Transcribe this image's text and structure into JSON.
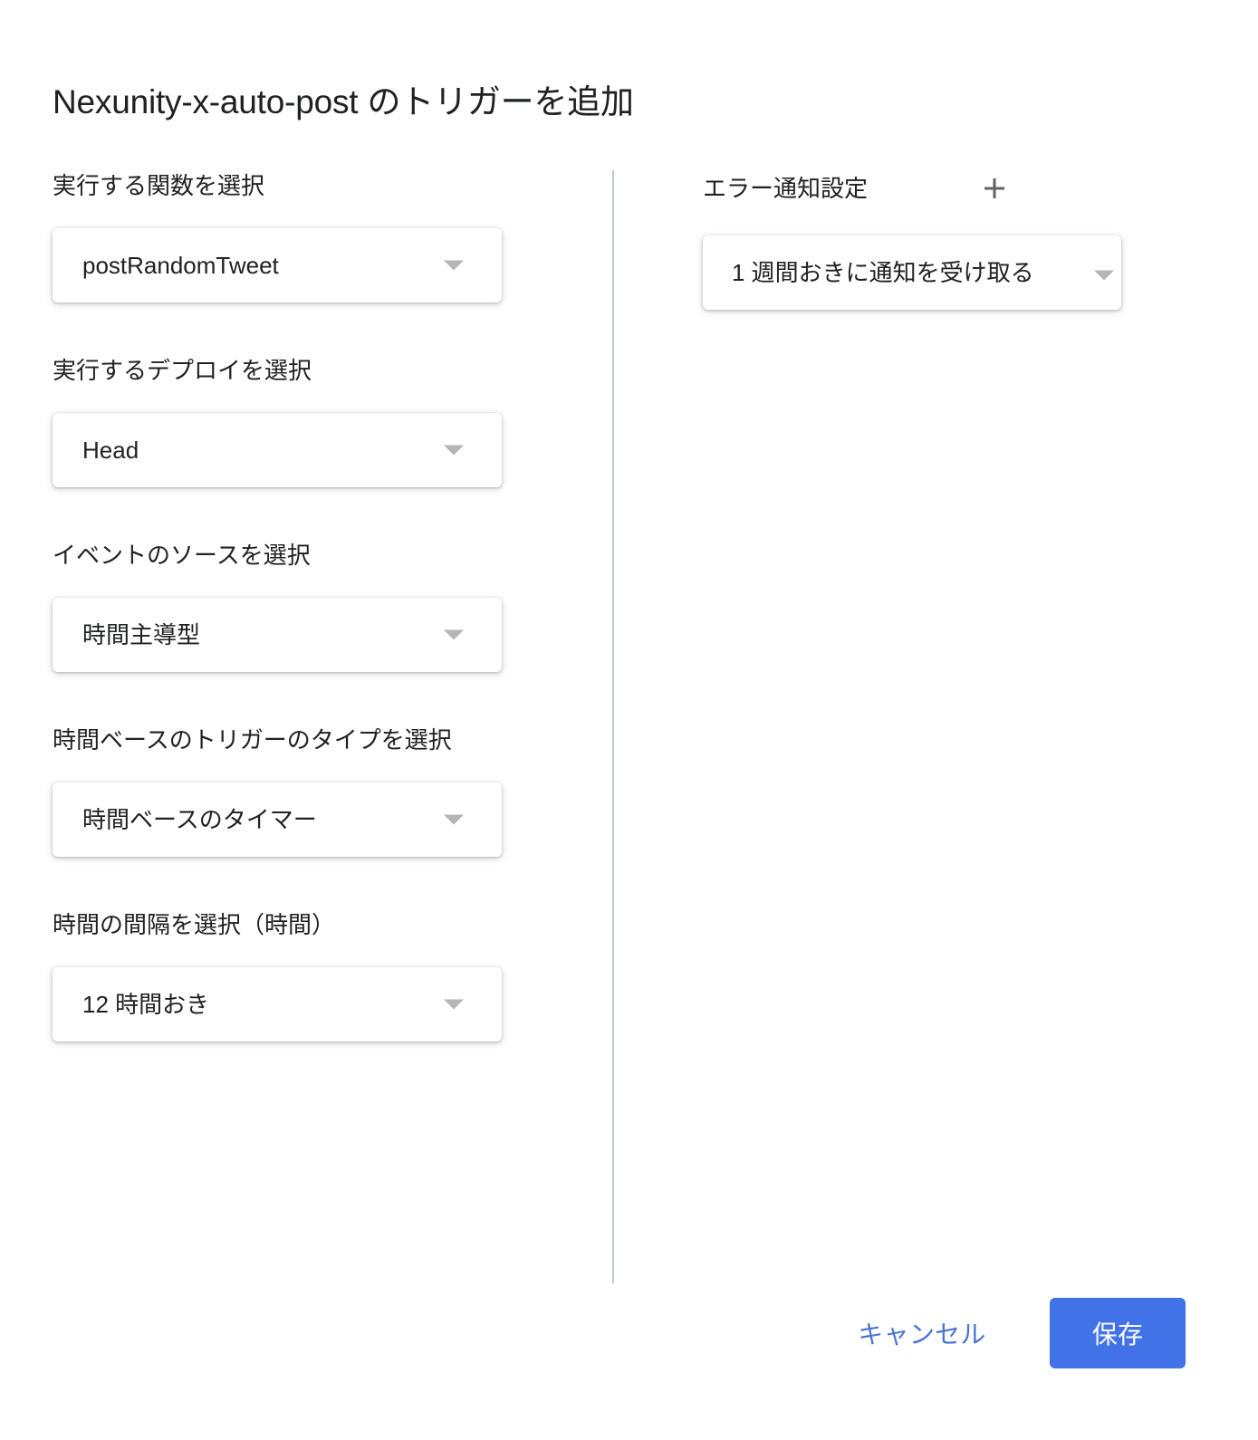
{
  "dialog": {
    "title": "Nexunity-x-auto-post のトリガーを追加"
  },
  "left_column": {
    "fields": [
      {
        "label": "実行する関数を選択",
        "value": "postRandomTweet",
        "arrow_icon": "chevron-down-icon"
      },
      {
        "label": "実行するデプロイを選択",
        "value": "Head",
        "arrow_icon": "chevron-down-icon"
      },
      {
        "label": "イベントのソースを選択",
        "value": "時間主導型",
        "arrow_icon": "chevron-down-icon"
      },
      {
        "label": "時間ベースのトリガーのタイプを選択",
        "value": "時間ベースのタイマー",
        "arrow_icon": "chevron-down-icon"
      },
      {
        "label": "時間の間隔を選択（時間）",
        "value": "12 時間おき",
        "arrow_icon": "chevron-down-icon"
      }
    ]
  },
  "right_column": {
    "header_label": "エラー通知設定",
    "add_icon": "plus-icon",
    "notification": {
      "value": "1 週間おきに通知を受け取る",
      "arrow_icon": "chevron-down-icon"
    }
  },
  "footer": {
    "cancel_label": "キャンセル",
    "save_label": "保存"
  },
  "colors": {
    "accent_blue": "#4272e8",
    "link_blue": "#4a74d4",
    "text_primary": "#202124",
    "divider": "#c3c7c9",
    "arrow_gray": "#b5b5b5",
    "icon_gray": "#5f6368",
    "background": "#ffffff"
  }
}
